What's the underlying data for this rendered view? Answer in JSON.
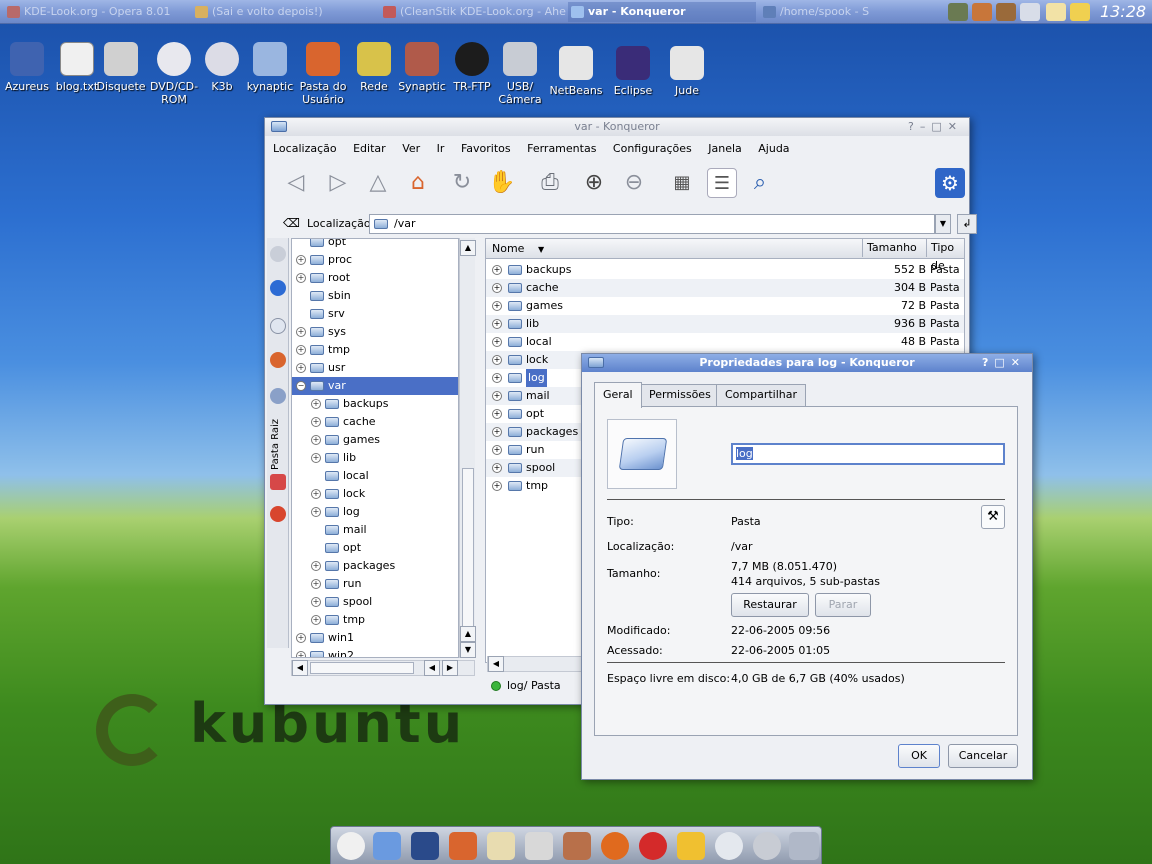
{
  "taskbar": {
    "tasks": [
      {
        "label": "KDE-Look.org - Opera 8.01",
        "active": false,
        "color": "#b86a6a"
      },
      {
        "label": "(Sai e volto depois!)",
        "active": false,
        "color": "#d8b060"
      },
      {
        "label": "(CleanStik KDE-Look.org - Ahe",
        "active": false,
        "color": "#c25a5a"
      },
      {
        "label": "var - Konqueror",
        "active": true,
        "color": "#9ec0ee"
      },
      {
        "label": "/home/spook - S",
        "active": false,
        "color": "#5f7fb8"
      }
    ],
    "clock": "13:28"
  },
  "desktop_icons": [
    {
      "label": "Azureus",
      "color": "#3f63b0"
    },
    {
      "label": "blog.txt",
      "color": "#f0f0f0"
    },
    {
      "label": "Disquete",
      "color": "#d0d0d0"
    },
    {
      "label": "DVD/CD-ROM",
      "color": "#e8e8ee"
    },
    {
      "label": "K3b",
      "color": "#dcdce6"
    },
    {
      "label": "kynaptic",
      "color": "#9ab6e0"
    },
    {
      "label": "Pasta do Usuário",
      "color": "#d9652e"
    },
    {
      "label": "Rede",
      "color": "#d8c24a"
    },
    {
      "label": "Synaptic",
      "color": "#b05a4a"
    },
    {
      "label": "TR-FTP",
      "color": "#1c1c1c"
    },
    {
      "label": "USB/ Câmera",
      "color": "#c8ccd4"
    },
    {
      "label": "NetBeans",
      "color": "#e6e6e6"
    },
    {
      "label": "Eclipse",
      "color": "#3a2c78"
    },
    {
      "label": "Jude",
      "color": "#e6e6e6"
    }
  ],
  "konqueror": {
    "title": "var - Konqueror",
    "menu": [
      "Localização",
      "Editar",
      "Ver",
      "Ir",
      "Favoritos",
      "Ferramentas",
      "Configurações",
      "Janela",
      "Ajuda"
    ],
    "location_label": "Localização:",
    "location_value": "/var",
    "sidebar_tab_label": "Pasta Raiz",
    "tree": [
      {
        "label": "opt",
        "indent": 0,
        "expander": "",
        "selected": false
      },
      {
        "label": "proc",
        "indent": 0,
        "expander": "+",
        "selected": false
      },
      {
        "label": "root",
        "indent": 0,
        "expander": "+",
        "selected": false
      },
      {
        "label": "sbin",
        "indent": 0,
        "expander": "",
        "selected": false
      },
      {
        "label": "srv",
        "indent": 0,
        "expander": "",
        "selected": false
      },
      {
        "label": "sys",
        "indent": 0,
        "expander": "+",
        "selected": false
      },
      {
        "label": "tmp",
        "indent": 0,
        "expander": "+",
        "selected": false
      },
      {
        "label": "usr",
        "indent": 0,
        "expander": "+",
        "selected": false
      },
      {
        "label": "var",
        "indent": 0,
        "expander": "-",
        "selected": true
      },
      {
        "label": "backups",
        "indent": 1,
        "expander": "+",
        "selected": false
      },
      {
        "label": "cache",
        "indent": 1,
        "expander": "+",
        "selected": false
      },
      {
        "label": "games",
        "indent": 1,
        "expander": "+",
        "selected": false
      },
      {
        "label": "lib",
        "indent": 1,
        "expander": "+",
        "selected": false
      },
      {
        "label": "local",
        "indent": 1,
        "expander": "",
        "selected": false
      },
      {
        "label": "lock",
        "indent": 1,
        "expander": "+",
        "selected": false
      },
      {
        "label": "log",
        "indent": 1,
        "expander": "+",
        "selected": false
      },
      {
        "label": "mail",
        "indent": 1,
        "expander": "",
        "selected": false
      },
      {
        "label": "opt",
        "indent": 1,
        "expander": "",
        "selected": false
      },
      {
        "label": "packages",
        "indent": 1,
        "expander": "+",
        "selected": false
      },
      {
        "label": "run",
        "indent": 1,
        "expander": "+",
        "selected": false
      },
      {
        "label": "spool",
        "indent": 1,
        "expander": "+",
        "selected": false
      },
      {
        "label": "tmp",
        "indent": 1,
        "expander": "+",
        "selected": false
      },
      {
        "label": "win1",
        "indent": 0,
        "expander": "+",
        "selected": false
      },
      {
        "label": "win2",
        "indent": 0,
        "expander": "+",
        "selected": false
      }
    ],
    "list_headers": {
      "name": "Nome",
      "size": "Tamanho",
      "type": "Tipo de"
    },
    "list": [
      {
        "name": "backups",
        "size": "552 B",
        "type": "Pasta"
      },
      {
        "name": "cache",
        "size": "304 B",
        "type": "Pasta"
      },
      {
        "name": "games",
        "size": "72 B",
        "type": "Pasta"
      },
      {
        "name": "lib",
        "size": "936 B",
        "type": "Pasta"
      },
      {
        "name": "local",
        "size": "48 B",
        "type": "Pasta"
      },
      {
        "name": "lock",
        "size": "",
        "type": ""
      },
      {
        "name": "log",
        "size": "",
        "type": ""
      },
      {
        "name": "mail",
        "size": "",
        "type": ""
      },
      {
        "name": "opt",
        "size": "",
        "type": ""
      },
      {
        "name": "packages",
        "size": "",
        "type": ""
      },
      {
        "name": "run",
        "size": "",
        "type": ""
      },
      {
        "name": "spool",
        "size": "",
        "type": ""
      },
      {
        "name": "tmp",
        "size": "",
        "type": ""
      }
    ],
    "selected_list_item": "log",
    "status": "log/  Pasta"
  },
  "properties": {
    "title": "Propriedades para log - Konqueror",
    "tabs": [
      "Geral",
      "Permissões",
      "Compartilhar"
    ],
    "active_tab": "Geral",
    "name_value": "log",
    "rows": {
      "tipo_label": "Tipo:",
      "tipo_value": "Pasta",
      "localizacao_label": "Localização:",
      "localizacao_value": "/var",
      "tamanho_label": "Tamanho:",
      "tamanho_value": "7,7 MB (8.051.470)",
      "tamanho_detail": "414 arquivos, 5 sub-pastas",
      "modificado_label": "Modificado:",
      "modificado_value": "22-06-2005 09:56",
      "acessado_label": "Acessado:",
      "acessado_value": "22-06-2005 01:05",
      "espaco_label": "Espaço livre em disco:",
      "espaco_value": "4,0 GB de 6,7 GB (40% usados)"
    },
    "restore_button": "Restaurar",
    "stop_button": "Parar",
    "ok_button": "OK",
    "cancel_button": "Cancelar"
  },
  "branding": {
    "logo_text": "kubuntu"
  },
  "dock": {
    "icons": [
      "eyes-icon",
      "folder-icon",
      "terminal-icon",
      "home-icon",
      "text-editor-icon",
      "notes-icon",
      "image-viewer-icon",
      "firefox-icon",
      "opera-icon",
      "runner-icon",
      "chat-icon",
      "audio-icon",
      "applets-icon"
    ]
  }
}
